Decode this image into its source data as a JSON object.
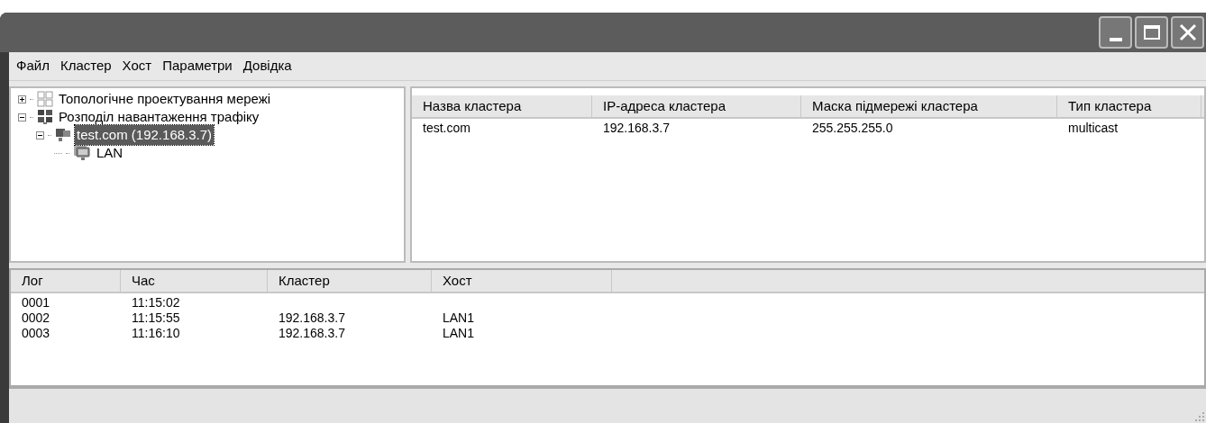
{
  "menu": [
    "Файл",
    "Кластер",
    "Хост",
    "Параметри",
    "Довідка"
  ],
  "tree": [
    {
      "label": "Топологічне проектування мережі",
      "kind": "grid",
      "expanded": false,
      "selected": false
    },
    {
      "label": "Розподіл навантаження трафіку",
      "kind": "group",
      "expanded": true,
      "selected": false,
      "children": [
        {
          "label": "test.com (192.168.3.7)",
          "kind": "host",
          "expanded": true,
          "selected": true,
          "children": [
            {
              "label": "LAN",
              "kind": "monitor",
              "selected": false
            }
          ]
        }
      ]
    }
  ],
  "clusters": {
    "columns": [
      "Назва кластера",
      "IP-адреса кластера",
      "Маска підмережі кластера",
      "Тип кластера"
    ],
    "rows": [
      [
        "test.com",
        "192.168.3.7",
        "255.255.255.0",
        "multicast"
      ]
    ]
  },
  "log": {
    "columns": [
      "Лог",
      "Час",
      "Кластер",
      "Хост"
    ],
    "rows": [
      [
        "0001",
        "11:15:02",
        "",
        ""
      ],
      [
        "0002",
        "11:15:55",
        "192.168.3.7",
        "LAN1"
      ],
      [
        "0003",
        "11:16:10",
        "192.168.3.7",
        "LAN1"
      ]
    ]
  }
}
